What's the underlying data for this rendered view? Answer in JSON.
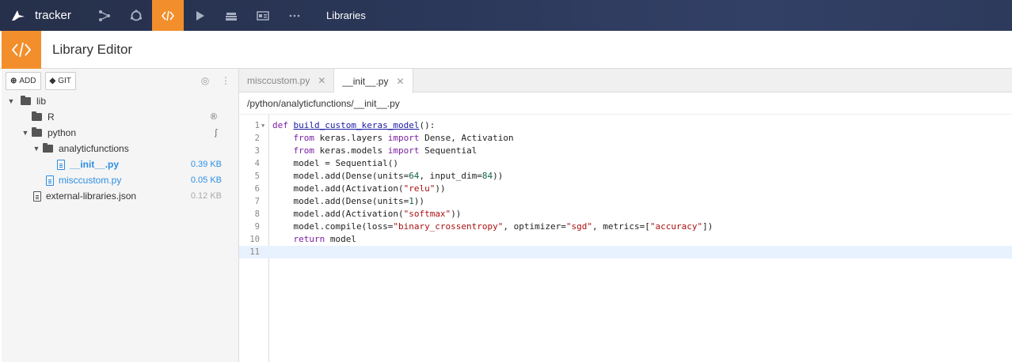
{
  "nav": {
    "app_name": "tracker",
    "section": "Libraries",
    "icons": [
      "flow-icon",
      "jobs-icon",
      "code-icon",
      "run-icon",
      "deploy-icon",
      "dashboard-icon",
      "more-icon"
    ],
    "accent": "#f28f2c"
  },
  "header": {
    "title": "Library Editor"
  },
  "toolbar": {
    "add_label": "ADD",
    "git_label": "GIT"
  },
  "tree": [
    {
      "label": "lib",
      "type": "folder",
      "depth": 0,
      "expanded": true
    },
    {
      "label": "R",
      "type": "folder",
      "depth": 1,
      "expanded": false,
      "icon": "r-icon"
    },
    {
      "label": "python",
      "type": "folder",
      "depth": 1,
      "expanded": true,
      "icon": "python-icon"
    },
    {
      "label": "analyticfunctions",
      "type": "folder",
      "depth": 2,
      "expanded": true
    },
    {
      "label": "__init__.py",
      "type": "file",
      "depth": 3,
      "size": "0.39 KB",
      "selected": true
    },
    {
      "label": "misccustom.py",
      "type": "file",
      "depth": 2,
      "size": "0.05 KB"
    },
    {
      "label": "external-libraries.json",
      "type": "file",
      "depth": 0,
      "size": "0.12 KB"
    }
  ],
  "tabs": [
    {
      "label": "misccustom.py",
      "active": false
    },
    {
      "label": "__init__.py",
      "active": true
    }
  ],
  "path": "/python/analyticfunctions/__init__.py",
  "code": [
    "def build_custom_keras_model():",
    "    from keras.layers import Dense, Activation",
    "    from keras.models import Sequential",
    "    model = Sequential()",
    "    model.add(Dense(units=64, input_dim=84))",
    "    model.add(Activation(\"relu\"))",
    "    model.add(Dense(units=1))",
    "    model.add(Activation(\"softmax\"))",
    "    model.compile(loss=\"binary_crossentropy\", optimizer=\"sgd\", metrics=[\"accuracy\"])",
    "    return model",
    ""
  ],
  "current_line": 11
}
